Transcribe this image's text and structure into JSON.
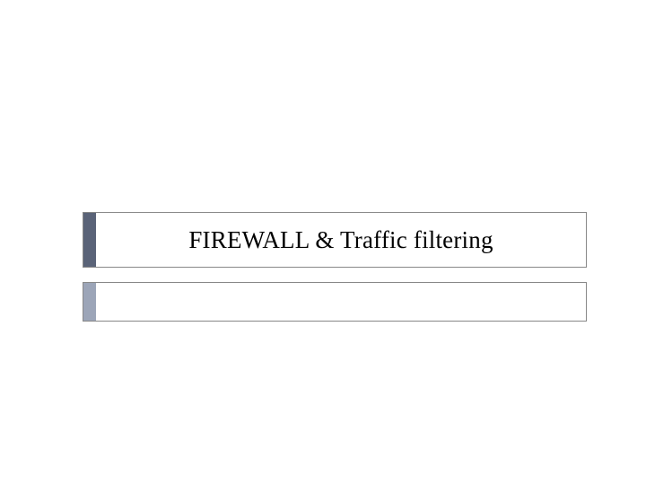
{
  "slide": {
    "title": "FIREWALL & Traffic filtering",
    "subtitle": ""
  },
  "colors": {
    "title_accent": "#5a6378",
    "subtitle_accent": "#9ca5b8",
    "border": "#888888"
  }
}
